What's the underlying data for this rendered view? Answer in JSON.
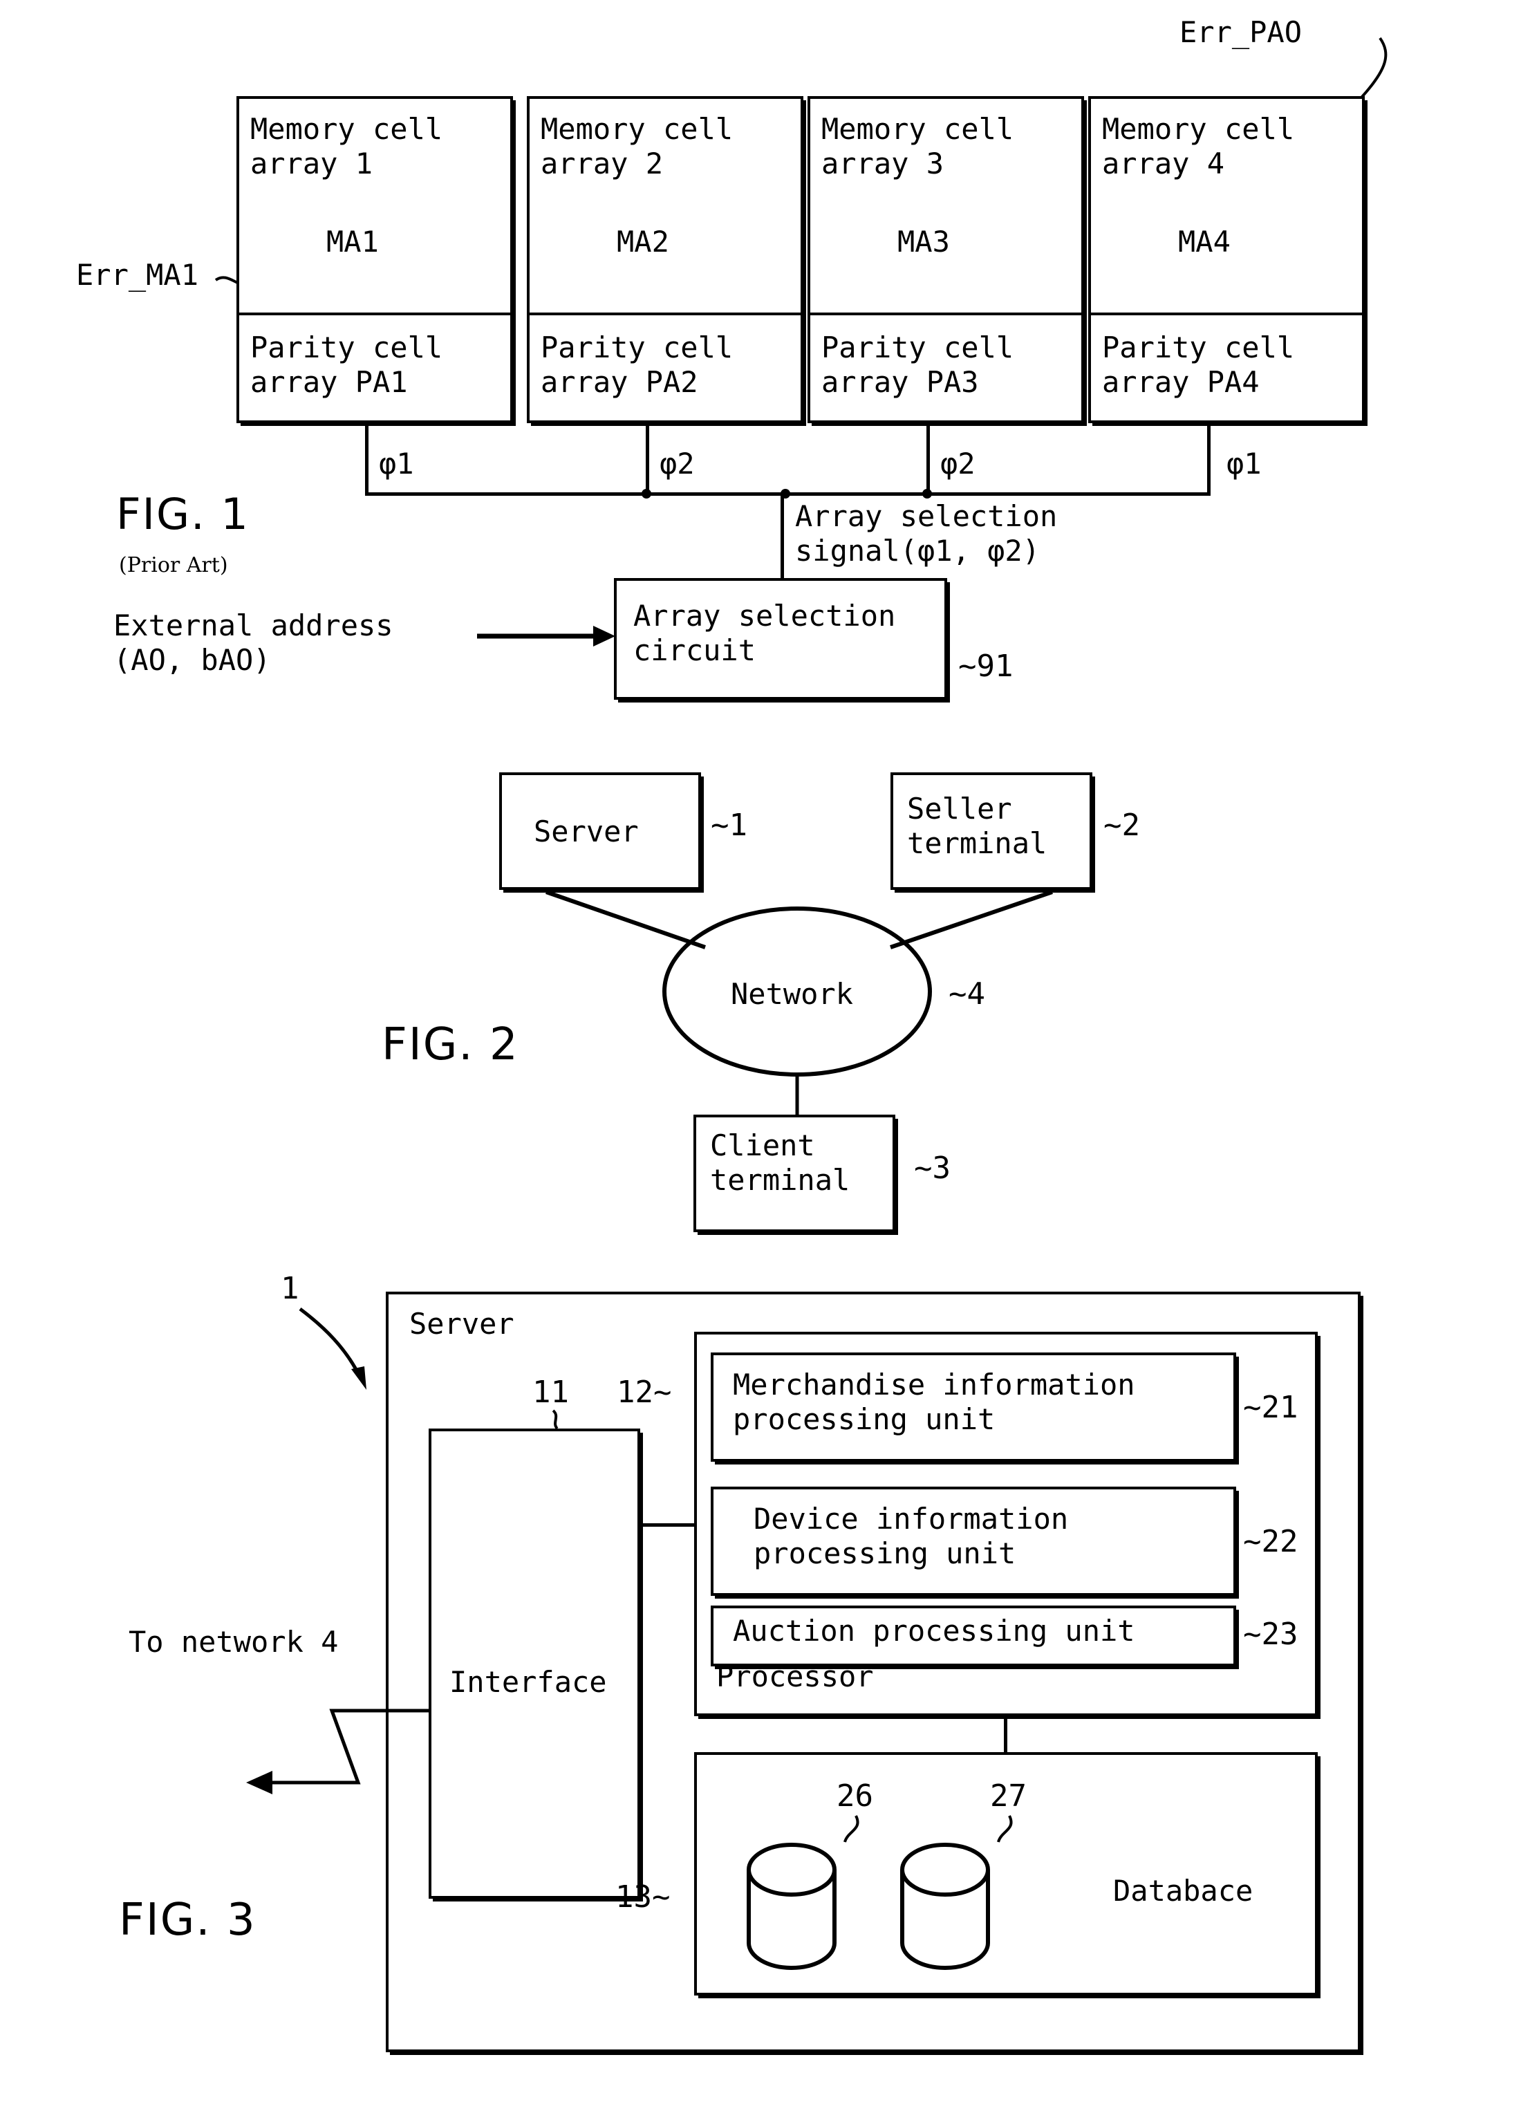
{
  "document": {
    "kind": "patent-drawing-sheet",
    "figures": [
      "FIG. 1",
      "FIG. 2",
      "FIG. 3"
    ]
  },
  "fig1": {
    "label": "FIG. 1",
    "sublabel": "(Prior Art)",
    "err_ma1": "Err_MA1",
    "err_pao": "Err_PAO",
    "x_mark": "×",
    "arrays": [
      {
        "title_line1": "Memory cell",
        "title_line2": "array 1",
        "code": "MA1",
        "parity_line1": "Parity cell",
        "parity_line2": "array PA1",
        "phi": "φ1"
      },
      {
        "title_line1": "Memory cell",
        "title_line2": "array 2",
        "code": "MA2",
        "parity_line1": "Parity cell",
        "parity_line2": "array PA2",
        "phi": "φ2"
      },
      {
        "title_line1": "Memory cell",
        "title_line2": "array 3",
        "code": "MA3",
        "parity_line1": "Parity cell",
        "parity_line2": "array PA3",
        "phi": "φ2"
      },
      {
        "title_line1": "Memory cell",
        "title_line2": "array 4",
        "code": "MA4",
        "parity_line1": "Parity cell",
        "parity_line2": "array PA4",
        "phi": "φ1"
      }
    ],
    "array_selection_signal_line1": "Array selection",
    "array_selection_signal_line2": "signal(φ1, φ2)",
    "external_address_line1": "External address",
    "external_address_line2": "(AO, bAO)",
    "selection_circuit_line1": "Array selection",
    "selection_circuit_line2": "circuit",
    "selection_circuit_ref": "~91"
  },
  "fig2": {
    "label": "FIG. 2",
    "server": {
      "text": "Server",
      "ref": "~1"
    },
    "seller_terminal": {
      "line1": "Seller",
      "line2": "terminal",
      "ref": "~2"
    },
    "network": {
      "text": "Network",
      "ref": "~4"
    },
    "client_terminal": {
      "line1": "Client",
      "line2": "terminal",
      "ref": "~3"
    }
  },
  "fig3": {
    "label": "FIG. 3",
    "server_ref": "1",
    "server_title": "Server",
    "interface_ref": "11",
    "interface_label": "Interface",
    "processor_ref": "12~",
    "processor_label": "Processor",
    "to_network": "To network 4",
    "units": [
      {
        "line1": "Merchandise information",
        "line2": "processing unit",
        "ref": "~21"
      },
      {
        "line1": "Device information",
        "line2": "processing unit",
        "ref": "~22"
      },
      {
        "line1": "Auction processing unit",
        "line2": "",
        "ref": "~23"
      }
    ],
    "database_ref": "13~",
    "database_label": "Databace",
    "db_cylinder_refs": [
      "26",
      "27"
    ]
  },
  "colors": {
    "ink": "#000000",
    "paper": "#ffffff"
  }
}
